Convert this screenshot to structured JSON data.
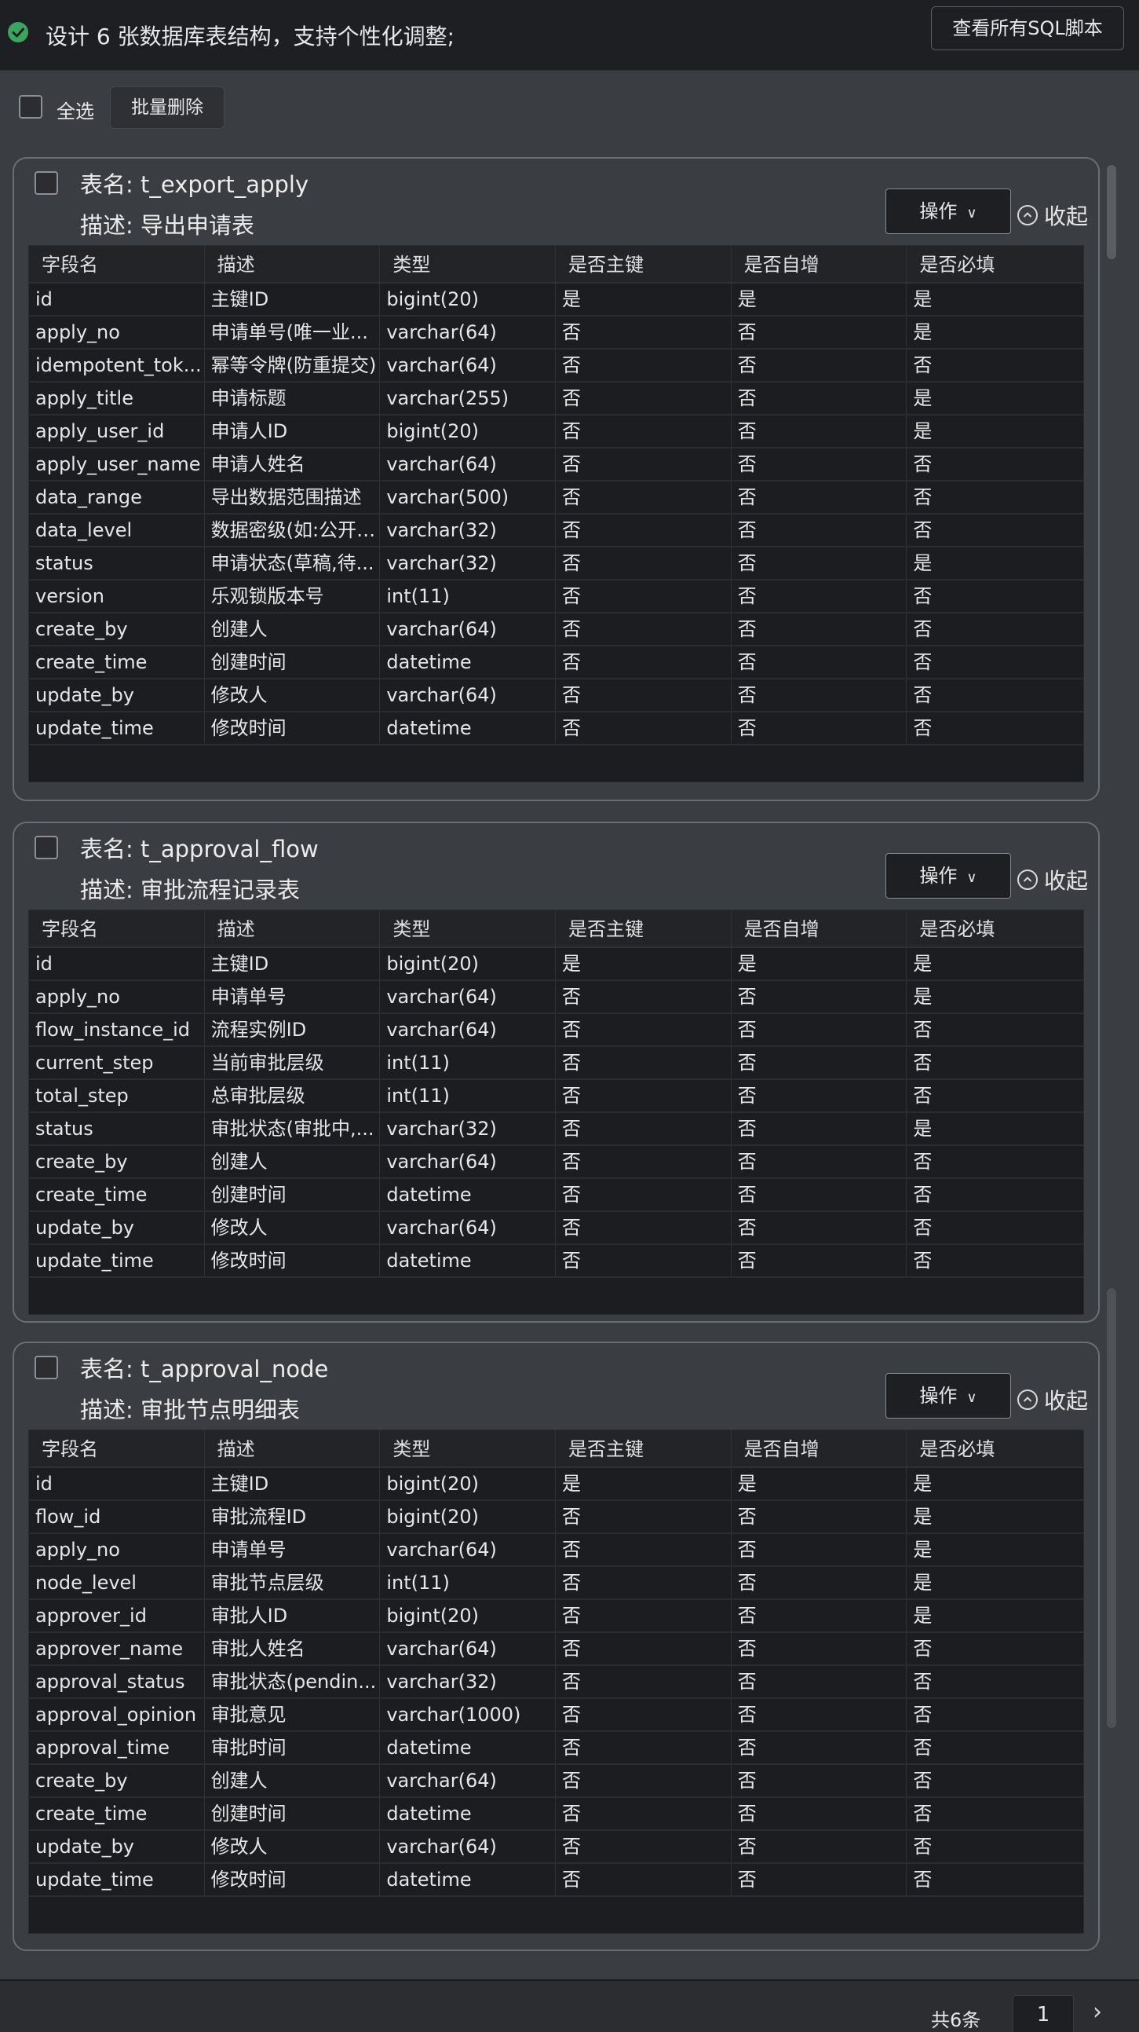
{
  "header": {
    "title": "设计 6 张数据库表结构，支持个性化调整;",
    "sql_button": "查看所有SQL脚本"
  },
  "bulk": {
    "select_all": "全选",
    "batch_delete": "批量删除"
  },
  "card_labels": {
    "operate": "操作",
    "collapse": "收起"
  },
  "columns": [
    "字段名",
    "描述",
    "类型",
    "是否主键",
    "是否自增",
    "是否必填"
  ],
  "tables": [
    {
      "name": "表名: t_export_apply",
      "desc": "描述: 导出申请表",
      "rows": [
        [
          "id",
          "主键ID",
          "bigint(20)",
          "是",
          "是",
          "是"
        ],
        [
          "apply_no",
          "申请单号(唯一业...",
          "varchar(64)",
          "否",
          "否",
          "是"
        ],
        [
          "idempotent_tok...",
          "幂等令牌(防重提交)",
          "varchar(64)",
          "否",
          "否",
          "否"
        ],
        [
          "apply_title",
          "申请标题",
          "varchar(255)",
          "否",
          "否",
          "是"
        ],
        [
          "apply_user_id",
          "申请人ID",
          "bigint(20)",
          "否",
          "否",
          "是"
        ],
        [
          "apply_user_name",
          "申请人姓名",
          "varchar(64)",
          "否",
          "否",
          "否"
        ],
        [
          "data_range",
          "导出数据范围描述",
          "varchar(500)",
          "否",
          "否",
          "否"
        ],
        [
          "data_level",
          "数据密级(如:公开,...",
          "varchar(32)",
          "否",
          "否",
          "否"
        ],
        [
          "status",
          "申请状态(草稿,待...",
          "varchar(32)",
          "否",
          "否",
          "是"
        ],
        [
          "version",
          "乐观锁版本号",
          "int(11)",
          "否",
          "否",
          "否"
        ],
        [
          "create_by",
          "创建人",
          "varchar(64)",
          "否",
          "否",
          "否"
        ],
        [
          "create_time",
          "创建时间",
          "datetime",
          "否",
          "否",
          "否"
        ],
        [
          "update_by",
          "修改人",
          "varchar(64)",
          "否",
          "否",
          "否"
        ],
        [
          "update_time",
          "修改时间",
          "datetime",
          "否",
          "否",
          "否"
        ]
      ]
    },
    {
      "name": "表名: t_approval_flow",
      "desc": "描述: 审批流程记录表",
      "rows": [
        [
          "id",
          "主键ID",
          "bigint(20)",
          "是",
          "是",
          "是"
        ],
        [
          "apply_no",
          "申请单号",
          "varchar(64)",
          "否",
          "否",
          "是"
        ],
        [
          "flow_instance_id",
          "流程实例ID",
          "varchar(64)",
          "否",
          "否",
          "否"
        ],
        [
          "current_step",
          "当前审批层级",
          "int(11)",
          "否",
          "否",
          "否"
        ],
        [
          "total_step",
          "总审批层级",
          "int(11)",
          "否",
          "否",
          "否"
        ],
        [
          "status",
          "审批状态(审批中,...",
          "varchar(32)",
          "否",
          "否",
          "是"
        ],
        [
          "create_by",
          "创建人",
          "varchar(64)",
          "否",
          "否",
          "否"
        ],
        [
          "create_time",
          "创建时间",
          "datetime",
          "否",
          "否",
          "否"
        ],
        [
          "update_by",
          "修改人",
          "varchar(64)",
          "否",
          "否",
          "否"
        ],
        [
          "update_time",
          "修改时间",
          "datetime",
          "否",
          "否",
          "否"
        ]
      ]
    },
    {
      "name": "表名: t_approval_node",
      "desc": "描述: 审批节点明细表",
      "rows": [
        [
          "id",
          "主键ID",
          "bigint(20)",
          "是",
          "是",
          "是"
        ],
        [
          "flow_id",
          "审批流程ID",
          "bigint(20)",
          "否",
          "否",
          "是"
        ],
        [
          "apply_no",
          "申请单号",
          "varchar(64)",
          "否",
          "否",
          "是"
        ],
        [
          "node_level",
          "审批节点层级",
          "int(11)",
          "否",
          "否",
          "是"
        ],
        [
          "approver_id",
          "审批人ID",
          "bigint(20)",
          "否",
          "否",
          "是"
        ],
        [
          "approver_name",
          "审批人姓名",
          "varchar(64)",
          "否",
          "否",
          "否"
        ],
        [
          "approval_status",
          "审批状态(pendin...",
          "varchar(32)",
          "否",
          "否",
          "否"
        ],
        [
          "approval_opinion",
          "审批意见",
          "varchar(1000)",
          "否",
          "否",
          "否"
        ],
        [
          "approval_time",
          "审批时间",
          "datetime",
          "否",
          "否",
          "否"
        ],
        [
          "create_by",
          "创建人",
          "varchar(64)",
          "否",
          "否",
          "否"
        ],
        [
          "create_time",
          "创建时间",
          "datetime",
          "否",
          "否",
          "否"
        ],
        [
          "update_by",
          "修改人",
          "varchar(64)",
          "否",
          "否",
          "否"
        ],
        [
          "update_time",
          "修改时间",
          "datetime",
          "否",
          "否",
          "否"
        ]
      ]
    }
  ],
  "pagination": {
    "total": "共6条",
    "current_page": "1"
  },
  "colors": {
    "success": "#3aa55c",
    "background": "#3a3d41",
    "table_bg": "#1c1d20"
  }
}
